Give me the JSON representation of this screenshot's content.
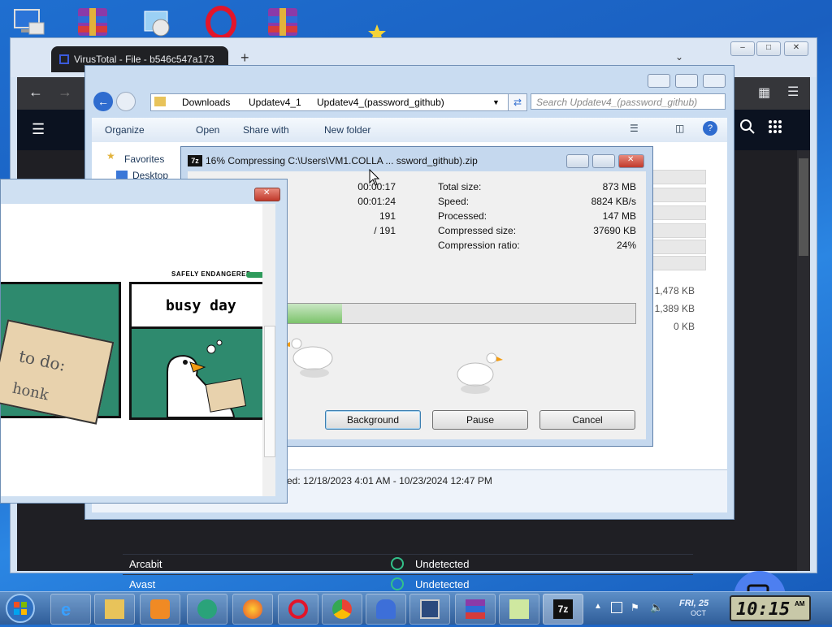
{
  "browser": {
    "tab_title": "VirusTotal - File - b546c547a173",
    "new_tab": "+",
    "rows": [
      {
        "engine": "Arcabit",
        "result": "Undetected"
      },
      {
        "engine": "Avast",
        "result": "Undetected"
      }
    ]
  },
  "explorer": {
    "breadcrumb": [
      "Downloads",
      "Updatev4_1",
      "Updatev4_(password_github)"
    ],
    "search_placeholder": "Search Updatev4_(password_github)",
    "commands": [
      "Organize",
      "Open",
      "Share with",
      "New folder"
    ],
    "nav": [
      "Favorites",
      "Desktop"
    ],
    "sizes": [
      "1,478 KB",
      "1,389 KB",
      "0 KB"
    ],
    "details_text": "ed: 12/18/2023 4:01 AM - 10/23/2024 12:47 PM"
  },
  "sevenzip": {
    "title": "16% Compressing C:\\Users\\VM1.COLLA ... ssword_github).zip",
    "left_values": [
      "00:00:17",
      "00:01:24",
      "191",
      "/ 191"
    ],
    "right_labels": [
      "Total size:",
      "Speed:",
      "Processed:",
      "Compressed size:",
      "Compression ratio:"
    ],
    "right_values": [
      "873 MB",
      "8824 KB/s",
      "147 MB",
      "37690 KB",
      "24%"
    ],
    "progress": 0.16,
    "buttons": {
      "background": "Background",
      "pause": "Pause",
      "cancel": "Cancel"
    }
  },
  "comic": {
    "badge": "SAFELY ENDANGERED",
    "panel2_caption": "busy day",
    "note_line1": "to do:",
    "note_line2": "honk"
  },
  "taskbar": {
    "date_day": "FRI, 25",
    "date_month": "OCT",
    "clock": "10:15",
    "clock_ampm": "AM"
  }
}
